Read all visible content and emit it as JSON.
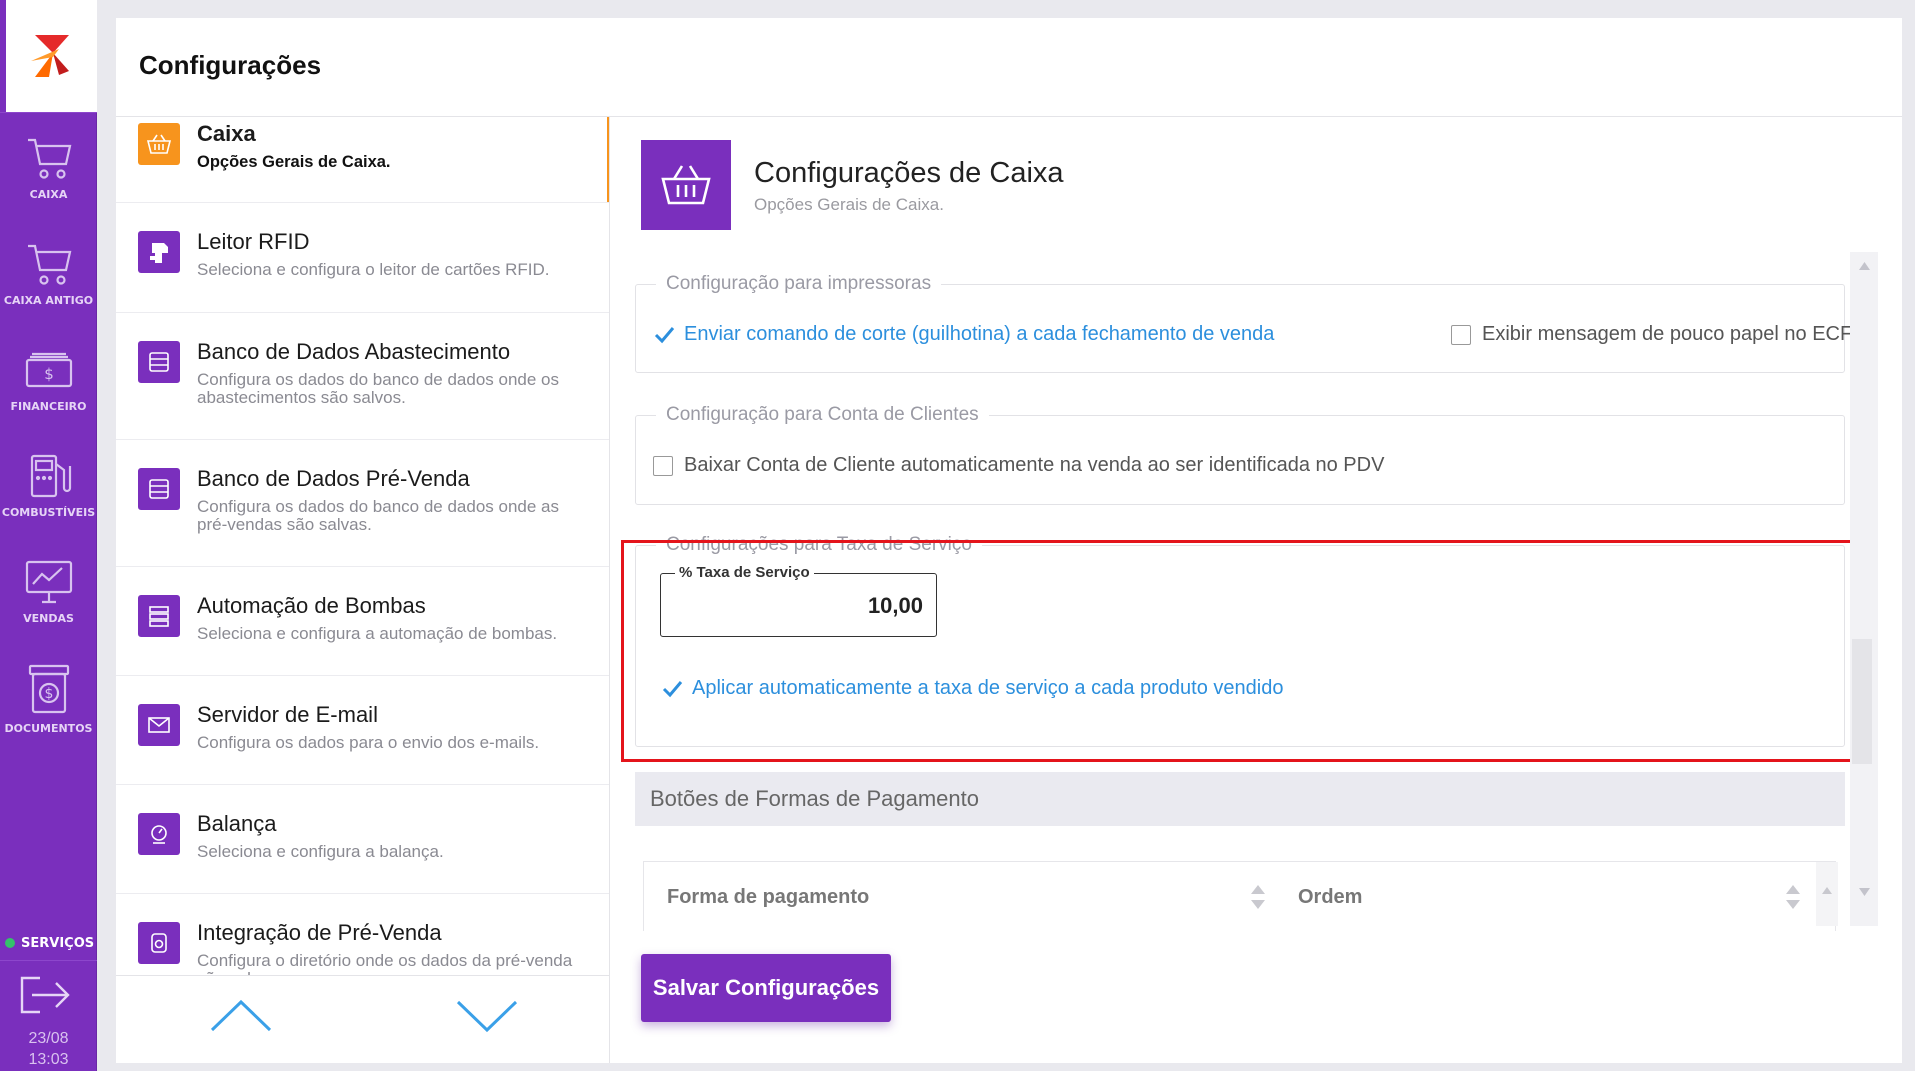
{
  "sidebar": {
    "items": [
      {
        "label": "CAIXA",
        "icon": "cart-icon"
      },
      {
        "label": "CAIXA ANTIGO",
        "icon": "cart-icon"
      },
      {
        "label": "FINANCEIRO",
        "icon": "money-icon"
      },
      {
        "label": "COMBUSTÍVEIS",
        "icon": "fuel-pump-icon"
      },
      {
        "label": "VENDAS",
        "icon": "monitor-chart-icon"
      },
      {
        "label": "DOCUMENTOS",
        "icon": "document-dollar-icon"
      }
    ],
    "services_label": "SERVIÇOS",
    "services_status_color": "#34c26a",
    "date": "23/08",
    "time": "13:03"
  },
  "page": {
    "title": "Configurações"
  },
  "settings_list": [
    {
      "title": "Caixa",
      "desc": "Opções Gerais de Caixa.",
      "icon": "basket-icon",
      "color": "#f7941d",
      "active": true
    },
    {
      "title": "Leitor RFID",
      "desc": "Seleciona e configura o leitor de cartões RFID.",
      "icon": "rfid-reader-icon",
      "color": "#7a2fbd"
    },
    {
      "title": "Banco de Dados Abastecimento",
      "desc": "Configura os dados do banco de dados onde os abastecimentos são salvos.",
      "icon": "database-icon",
      "color": "#7a2fbd"
    },
    {
      "title": "Banco de Dados Pré-Venda",
      "desc": "Configura os dados do banco de dados onde as pré-vendas são salvas.",
      "icon": "database-icon",
      "color": "#7a2fbd"
    },
    {
      "title": "Automação de Bombas",
      "desc": "Seleciona e configura a automação de bombas.",
      "icon": "server-icon",
      "color": "#7a2fbd"
    },
    {
      "title": "Servidor de E-mail",
      "desc": "Configura os dados para o envio dos e-mails.",
      "icon": "envelope-icon",
      "color": "#7a2fbd"
    },
    {
      "title": "Balança",
      "desc": "Seleciona e configura a balança.",
      "icon": "scale-icon",
      "color": "#7a2fbd"
    },
    {
      "title": "Integração de Pré-Venda",
      "desc": "Configura o diretório onde os dados da pré-venda são salvos.",
      "icon": "integration-icon",
      "color": "#7a2fbd"
    }
  ],
  "detail": {
    "title": "Configurações de Caixa",
    "subtitle": "Opções Gerais de Caixa.",
    "printers": {
      "legend": "Configuração para impressoras",
      "cut_command": {
        "label": "Enviar comando de corte (guilhotina) a cada fechamento de venda",
        "checked": true
      },
      "low_paper": {
        "label": "Exibir mensagem de pouco papel no ECF",
        "checked": false
      }
    },
    "client_account": {
      "legend": "Configuração para Conta de Clientes",
      "auto_settle": {
        "label": "Baixar Conta de Cliente automaticamente na venda ao ser identificada no PDV",
        "checked": false
      }
    },
    "service_fee": {
      "legend": "Configurações para Taxa de Serviço",
      "field_label": "% Taxa de Serviço",
      "field_value": "10,00",
      "auto_apply": {
        "label": "Aplicar automaticamente a taxa de serviço a cada produto vendido",
        "checked": true
      }
    },
    "payment_buttons": {
      "heading": "Botões de Formas de Pagamento",
      "columns": [
        "Forma de pagamento",
        "Ordem"
      ]
    },
    "save_label": "Salvar Configurações"
  },
  "colors": {
    "accent": "#7a2fbd",
    "active_orange": "#f7941d",
    "check_blue": "#2c8fdd",
    "highlight_red": "#e4141b"
  }
}
